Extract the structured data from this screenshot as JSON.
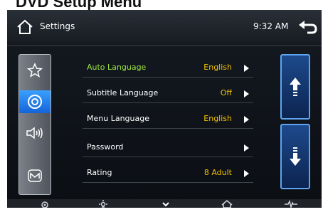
{
  "caption": "DVD Setup Menu",
  "header": {
    "title": "Settings",
    "time": "9:32 AM"
  },
  "left_nav": {
    "icons": [
      "star-icon",
      "disc-icon",
      "speaker-icon",
      "m-logo-icon"
    ],
    "active_index": 1
  },
  "settings": [
    {
      "label": "Auto Language",
      "value": "English",
      "highlighted": true
    },
    {
      "label": "Subtitle Language",
      "value": "Off"
    },
    {
      "label": "Menu Language",
      "value": "English"
    },
    {
      "label": "Password",
      "value": ""
    },
    {
      "label": "Rating",
      "value": "8 Adult"
    }
  ],
  "scroll_buttons": [
    "scroll-up-icon",
    "scroll-down-icon"
  ],
  "bottom_bar": {
    "icons": [
      "gear-icon",
      "brightness-icon",
      "chevron-down-icon",
      "home-icon",
      "waveform-icon"
    ]
  },
  "colors": {
    "highlight_label": "#9ce63a",
    "value_text": "#f2c200",
    "active_nav": "#1464d8",
    "scroll_border": "#5fa4f0"
  }
}
